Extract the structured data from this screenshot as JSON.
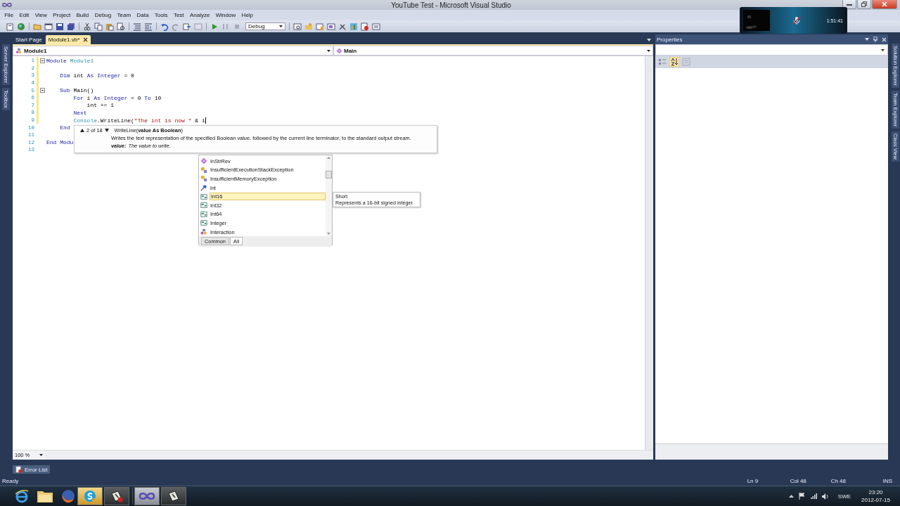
{
  "window": {
    "title": "YouTube Test - Microsoft Visual Studio"
  },
  "menu": [
    "File",
    "Edit",
    "View",
    "Project",
    "Build",
    "Debug",
    "Team",
    "Data",
    "Tools",
    "Test",
    "Analyze",
    "Window",
    "Help"
  ],
  "toolbar": {
    "configuration": "Debug"
  },
  "recorder": {
    "time": "1:51:41"
  },
  "left_dock": [
    "Server Explorer",
    "Toolbox"
  ],
  "document_tabs": [
    {
      "label": "Start Page",
      "selected": false
    },
    {
      "label": "Module1.vb*",
      "selected": true
    }
  ],
  "editor": {
    "type_combo": "Module1",
    "member_combo": "Main",
    "zoom": "100 %",
    "lines": [
      {
        "number": "1",
        "fold": true,
        "changed": true,
        "caret": false,
        "tokens": [
          {
            "kind": "keyword",
            "text": "Module"
          },
          {
            "kind": "type",
            "text": " Module1"
          }
        ]
      },
      {
        "number": "2",
        "fold": false,
        "changed": true,
        "caret": false
      },
      {
        "number": "3",
        "fold": false,
        "changed": true,
        "caret": false,
        "tokens": [
          {
            "kind": "keyword",
            "text": "    Dim"
          },
          {
            "kind": "plain",
            "text": " int "
          },
          {
            "kind": "keyword",
            "text": "As Integer"
          },
          {
            "kind": "plain",
            "text": " = 0"
          }
        ]
      },
      {
        "number": "4",
        "fold": false,
        "changed": true,
        "caret": false
      },
      {
        "number": "5",
        "fold": true,
        "changed": true,
        "caret": false,
        "tokens": [
          {
            "kind": "keyword",
            "text": "    Sub"
          },
          {
            "kind": "plain",
            "text": " Main()"
          }
        ]
      },
      {
        "number": "6",
        "fold": false,
        "changed": true,
        "caret": false,
        "tokens": [
          {
            "kind": "keyword",
            "text": "        For"
          },
          {
            "kind": "plain",
            "text": " i "
          },
          {
            "kind": "keyword",
            "text": "As Integer"
          },
          {
            "kind": "plain",
            "text": " = 0 "
          },
          {
            "kind": "keyword",
            "text": "To"
          },
          {
            "kind": "plain",
            "text": " 10"
          }
        ]
      },
      {
        "number": "7",
        "fold": false,
        "changed": true,
        "caret": false,
        "tokens": [
          {
            "kind": "plain",
            "text": "            int += 1"
          }
        ]
      },
      {
        "number": "8",
        "fold": false,
        "changed": true,
        "caret": false,
        "tokens": [
          {
            "kind": "keyword",
            "text": "        Next"
          }
        ]
      },
      {
        "number": "9",
        "fold": false,
        "changed": true,
        "caret": true,
        "tokens": [
          {
            "kind": "type",
            "text": "        Console"
          },
          {
            "kind": "plain",
            "text": ".WriteLine("
          },
          {
            "kind": "string",
            "text": "\"The int is now \""
          },
          {
            "kind": "plain",
            "text": " & i"
          }
        ]
      },
      {
        "number": "10",
        "fold": false,
        "changed": false,
        "caret": false,
        "tokens": [
          {
            "kind": "keyword",
            "text": "    End"
          }
        ]
      },
      {
        "number": "11",
        "fold": false,
        "changed": false,
        "caret": false
      },
      {
        "number": "12",
        "fold": false,
        "changed": false,
        "caret": false,
        "tokens": [
          {
            "kind": "keyword",
            "text": "End Modu"
          }
        ]
      },
      {
        "number": "13",
        "fold": false,
        "changed": false,
        "caret": false
      }
    ]
  },
  "parameter_info": {
    "counter": "2 of 18",
    "signature": "WriteLine(**value As Boolean**)",
    "description": "Writes the text representation of the specified Boolean value, followed by the current line terminator, to the standard output stream.",
    "parameter_name": "value:",
    "parameter_description": "The value to write."
  },
  "completion_list": {
    "items": [
      {
        "label": "InStrRev",
        "kind": "method",
        "selected": false
      },
      {
        "label": "InsufficientExecutionStackException",
        "kind": "class",
        "selected": false
      },
      {
        "label": "InsufficientMemoryException",
        "kind": "class",
        "selected": false
      },
      {
        "label": "int",
        "kind": "field",
        "selected": false
      },
      {
        "label": "Int16",
        "kind": "structure",
        "selected": true
      },
      {
        "label": "Int32",
        "kind": "structure",
        "selected": false
      },
      {
        "label": "Int64",
        "kind": "structure",
        "selected": false
      },
      {
        "label": "Integer",
        "kind": "structure",
        "selected": false
      },
      {
        "label": "Interaction",
        "kind": "module",
        "selected": false
      }
    ],
    "tabs": [
      {
        "label": "Common",
        "selected": false
      },
      {
        "label": "All",
        "selected": true
      }
    ]
  },
  "completion_tooltip": {
    "title": "Short",
    "description": "Represents a 16-bit signed integer."
  },
  "properties": {
    "title": "Properties"
  },
  "right_dock": [
    "Solution Explorer",
    "Team Explorer",
    "Class View"
  ],
  "bottom_tabs": [
    "Error List"
  ],
  "status_bar": {
    "message": "Ready",
    "line": "Ln 9",
    "column": "Col 48",
    "character": "Ch 48",
    "mode": "INS"
  },
  "taskbar": {
    "language": "SWE",
    "time": "23:20",
    "date": "2012-07-15"
  }
}
